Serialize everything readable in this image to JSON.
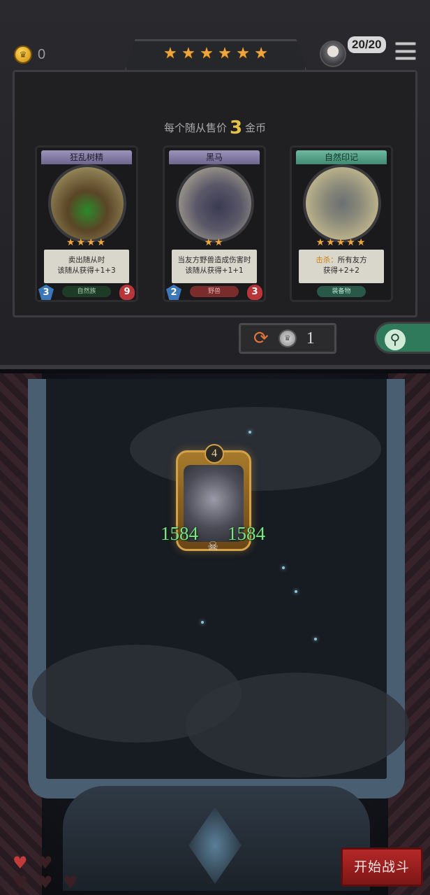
{
  "header": {
    "gold": "0",
    "tavern_stars": 6,
    "player_count": "20/20"
  },
  "shop": {
    "price_prefix": "每个随从售价",
    "price_value": "3",
    "price_suffix": "金币",
    "cards": [
      {
        "name": "狂乱树精",
        "stars": "★★★★",
        "desc_line1": "卖出随从时",
        "desc_line2": "该随从获得+1+3",
        "tag": "自然族",
        "attack": "3",
        "health": "9"
      },
      {
        "name": "黑马",
        "stars": "★★",
        "desc_line1": "当友方野兽造成伤害时",
        "desc_line2": "该随从获得+1+1",
        "tag": "野兽",
        "attack": "2",
        "health": "3"
      },
      {
        "name": "自然印记",
        "stars": "★★★★★",
        "desc_keyword": "击杀：",
        "desc_line1": "所有友方",
        "desc_line2": "获得+2+2",
        "tag": "装备物"
      }
    ],
    "refresh_cost": "1"
  },
  "battle": {
    "minion": {
      "tier": "4",
      "attack": "1584",
      "health": "1584"
    },
    "lives_total": 5,
    "lives_full": 1,
    "start_label": "开始战斗"
  },
  "colors": {
    "accent_gold": "#f0a63a",
    "start_red": "#b52828",
    "stat_green": "#7ee08a"
  },
  "icons": [
    "coin-icon",
    "avatar-icon",
    "menu-icon",
    "refresh-icon",
    "silver-coin-icon",
    "search-icon",
    "heart-icon",
    "skull-icon"
  ]
}
